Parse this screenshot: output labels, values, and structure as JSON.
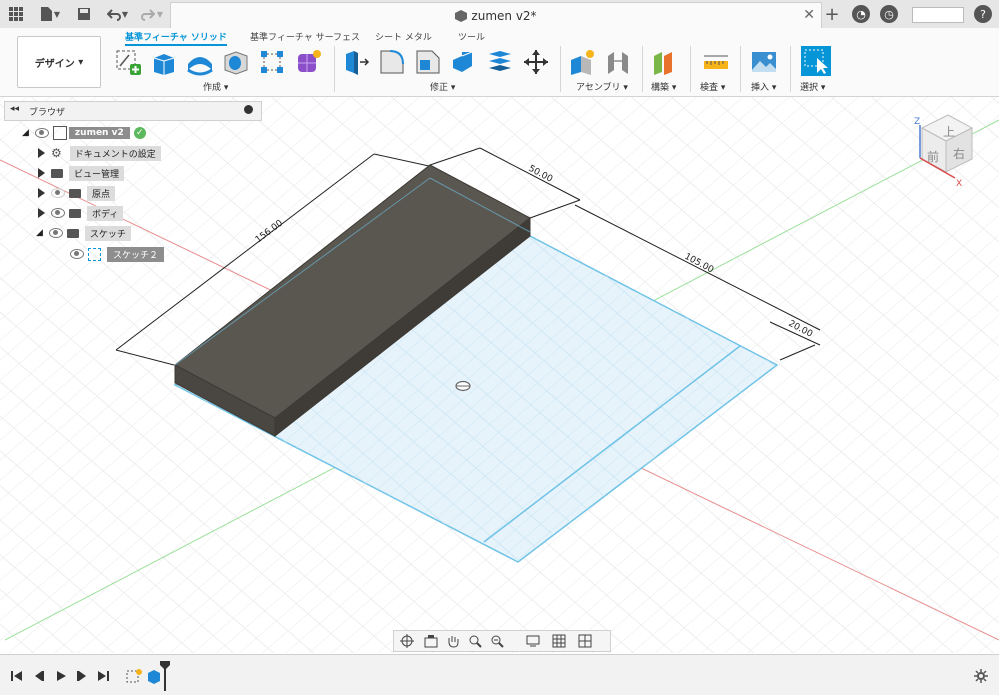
{
  "titlebar": {
    "doc_title": "zumen v2*",
    "icons": [
      "grid-icon",
      "file-icon",
      "save-icon",
      "undo-icon",
      "redo-icon",
      "close-icon",
      "plus-icon",
      "job-status-icon",
      "history-icon",
      "help-icon"
    ]
  },
  "ribbon": {
    "workspace": "デザイン",
    "tabs": [
      "基準フィーチャ ソリッド",
      "基準フィーチャ サーフェス",
      "シート メタル",
      "ツール"
    ],
    "groups": {
      "create": "作成",
      "modify": "修正",
      "assemble": "アセンブリ",
      "construct": "構築",
      "inspect": "検査",
      "insert": "挿入",
      "select": "選択"
    }
  },
  "browser": {
    "title": "ブラウザ",
    "root": "zumen v2",
    "items": [
      "ドキュメントの設定",
      "ビュー管理",
      "原点",
      "ボディ",
      "スケッチ",
      "スケッチ２"
    ]
  },
  "viewcube": {
    "top": "上",
    "front": "前",
    "right": "右",
    "z": "Z",
    "x": "X"
  },
  "dimensions": {
    "d1": "156.00",
    "d2": "50.00",
    "d3": "105.00",
    "d4": "20.00"
  },
  "colors": {
    "accent": "#0696d7",
    "sketch_fill": "#e6f3fb",
    "sketch_line": "#6fc3e6",
    "body": "#5a5650"
  }
}
